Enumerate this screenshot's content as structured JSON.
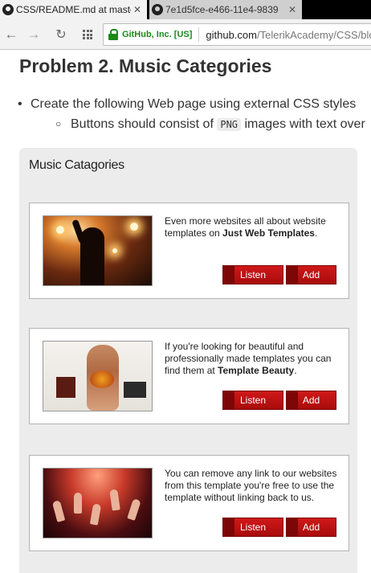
{
  "browser": {
    "tabs": [
      {
        "title": "CSS/README.md at maste",
        "close": "✕",
        "active": true
      },
      {
        "title": "7e1d5fce-e466-11e4-9839",
        "close": "✕",
        "active": false
      }
    ],
    "toolbar": {
      "back_icon": "←",
      "forward_icon": "→",
      "reload_icon": "↻",
      "certificate": "GitHub, Inc. [US]",
      "url_host": "github.com",
      "url_path": "/TelerikAcademy/CSS/blo"
    }
  },
  "readme": {
    "heading": "Problem 2. Music Categories",
    "bullet": "Create the following Web page using external CSS styles",
    "subbullet_before": "Buttons should consist of",
    "subbullet_code": "PNG",
    "subbullet_after": "images with text over"
  },
  "demo": {
    "title": "Music Catagories",
    "cards": [
      {
        "text_before": "Even more websites all about website templates on ",
        "text_bold": "Just Web Templates",
        "text_after": ".",
        "listen_label": "Listen",
        "add_label": "Add"
      },
      {
        "text_before": "If you're looking for beautiful and professionally made templates you can find them at ",
        "text_bold": "Template Beauty",
        "text_after": ".",
        "listen_label": "Listen",
        "add_label": "Add"
      },
      {
        "text_before": "You can remove any link to our websites from this template you're free to use the template without linking back to us.",
        "text_bold": "",
        "text_after": "",
        "listen_label": "Listen",
        "add_label": "Add"
      }
    ]
  },
  "colors": {
    "button_red": "#c01212",
    "certificate_green": "#1a8a1a",
    "demo_background": "#ececec"
  }
}
